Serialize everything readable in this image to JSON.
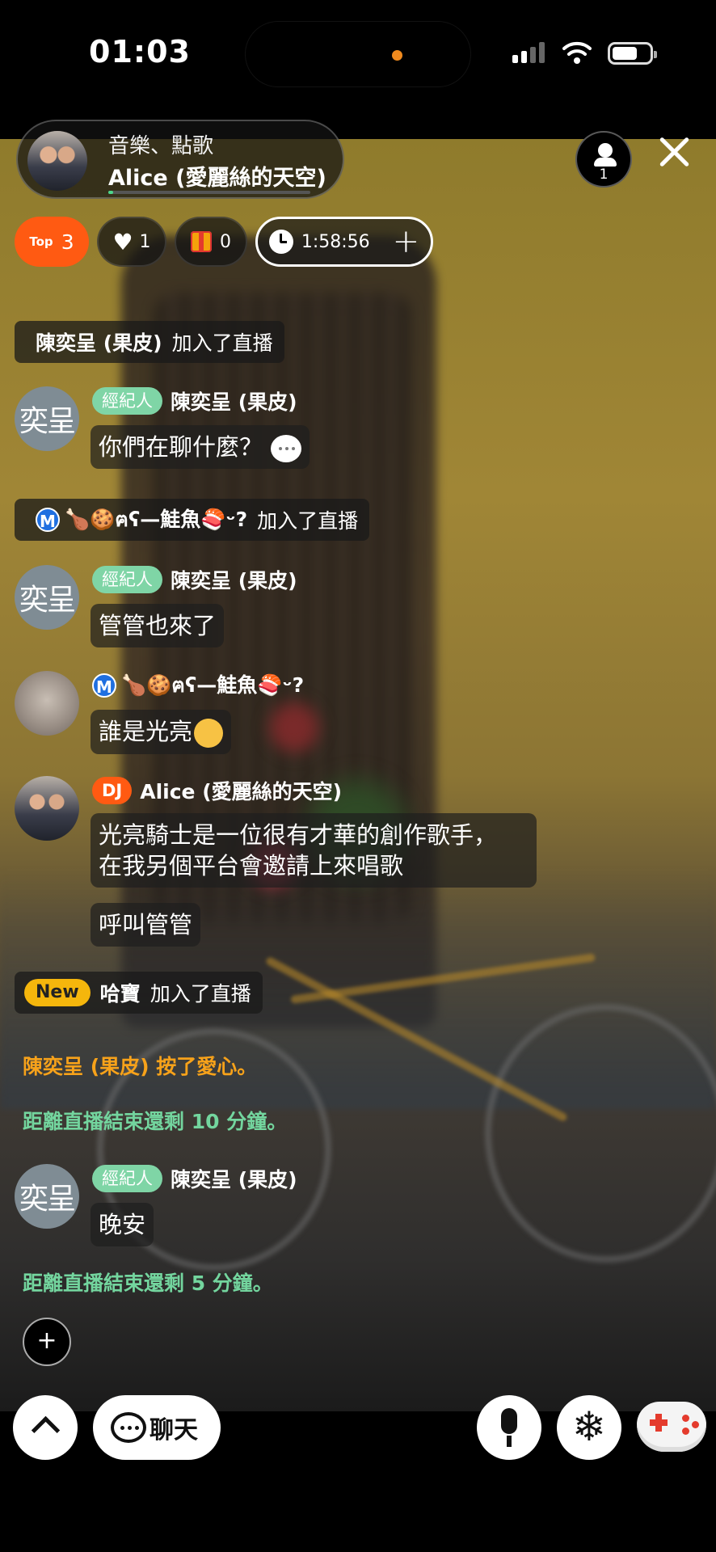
{
  "status_bar": {
    "time": "01:03"
  },
  "host": {
    "subtitle": "音樂、點歌",
    "name": "Alice (愛麗絲的天空)"
  },
  "viewers": {
    "count": "1"
  },
  "stats": {
    "top_label": "Top",
    "top_value": "3",
    "likes": "1",
    "gifts": "0",
    "timer": "1:58:56",
    "timer_add": "+"
  },
  "feed": {
    "join1": {
      "name": "陳奕呈 (果皮)",
      "action": "加入了直播"
    },
    "msg1": {
      "avatar_text": "奕呈",
      "badge": "經紀人",
      "name": "陳奕呈 (果皮)",
      "text": "你們在聊什麼？"
    },
    "join2": {
      "badge": "M",
      "name": "🍗🍪ฅʕ—鮭魚🍣ᵕ? ",
      "action": "加入了直播"
    },
    "msg2": {
      "avatar_text": "奕呈",
      "badge": "經紀人",
      "name": "陳奕呈 (果皮)",
      "text": "管管也來了"
    },
    "msg3": {
      "badge": "M",
      "name": "🍗🍪ฅʕ—鮭魚🍣ᵕ?",
      "text": "誰是光亮"
    },
    "msg4": {
      "badge": "DJ",
      "name": "Alice (愛麗絲的天空)",
      "line1": "光亮騎士是一位很有才華的創作歌手，",
      "line2": "在我另個平台會邀請上來唱歌",
      "followup": "呼叫管管"
    },
    "join3": {
      "badge": "New",
      "name": "哈寶",
      "action": "加入了直播"
    },
    "notice1": "陳奕呈 (果皮) 按了愛心。",
    "notice2": "距離直播結束還剩 10 分鐘。",
    "msg5": {
      "avatar_text": "奕呈",
      "badge": "經紀人",
      "name": "陳奕呈 (果皮)",
      "text": "晚安"
    },
    "notice3": "距離直播結束還剩 5 分鐘。"
  },
  "controls": {
    "add": "+",
    "chat_label": "聊天",
    "snow": "❄"
  },
  "colors": {
    "accent_orange": "#ff5a12",
    "agent_green": "#7fd5a6",
    "notice_orange": "#f7a21a",
    "notice_green": "#73d59e",
    "new_yellow": "#f5b60c"
  }
}
